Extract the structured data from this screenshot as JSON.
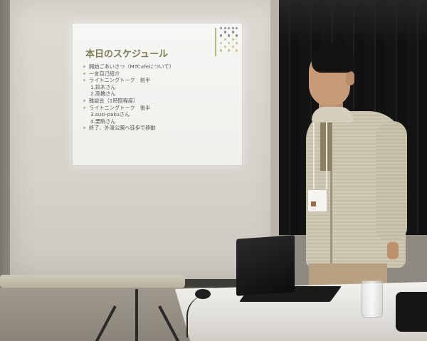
{
  "slide": {
    "title": "本日のスケジュール",
    "items": [
      {
        "text": "開始ごあいさつ（MTCafeについて）",
        "type": "bullet"
      },
      {
        "text": "一言自己紹介",
        "type": "bullet"
      },
      {
        "text": "ライトニングトーク　前半",
        "type": "bullet"
      },
      {
        "text": "1.鈴木さん",
        "type": "sub"
      },
      {
        "text": "2.高橋さん",
        "type": "sub"
      },
      {
        "text": "雑談会（1時間程度）",
        "type": "bullet"
      },
      {
        "text": "ライトニングトーク　後半",
        "type": "bullet"
      },
      {
        "text": "3.susi-pakuさん",
        "type": "sub"
      },
      {
        "text": "4.栗駒さん",
        "type": "sub"
      },
      {
        "text": "終了、外濠公園へ徒歩で移動",
        "type": "bullet"
      }
    ]
  },
  "colors": {
    "slide_title": "#7b7a52",
    "bullet": "#b3b07a",
    "dot_light": "#c7c18a",
    "dot_dark": "#8c8f96"
  }
}
